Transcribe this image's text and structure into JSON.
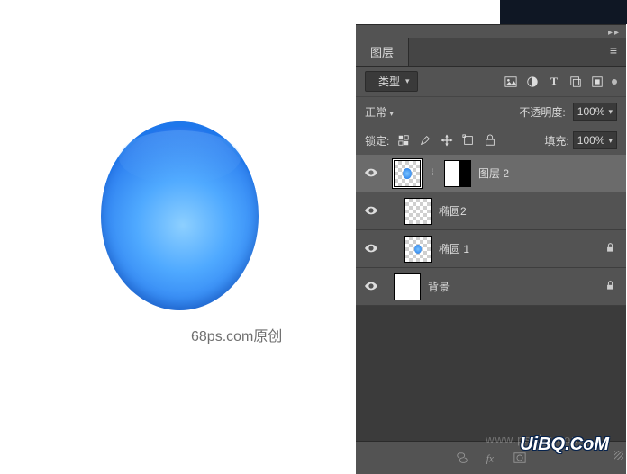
{
  "canvas": {
    "credit": "68ps.com原创"
  },
  "panel": {
    "title": "图层",
    "type_filter": {
      "label": "类型",
      "search_icon": "search"
    },
    "blend_mode": {
      "value": "正常"
    },
    "opacity": {
      "label": "不透明度:",
      "value": "100%"
    },
    "lock": {
      "label": "锁定:"
    },
    "fill": {
      "label": "填充:",
      "value": "100%"
    },
    "layers": [
      {
        "name": "图层 2",
        "visible": true,
        "selected": true,
        "indent": 1,
        "has_mask": true,
        "locked": false,
        "thumb": "checker-ellipse"
      },
      {
        "name": "椭圆2",
        "visible": true,
        "selected": false,
        "indent": 2,
        "has_mask": false,
        "locked": false,
        "thumb": "checker"
      },
      {
        "name": "椭圆 1",
        "visible": true,
        "selected": false,
        "indent": 2,
        "has_mask": false,
        "locked": true,
        "thumb": "checker-ellipse"
      },
      {
        "name": "背景",
        "visible": true,
        "selected": false,
        "indent": 1,
        "has_mask": false,
        "locked": true,
        "thumb": "white"
      }
    ]
  },
  "watermark": {
    "text1": "www.psahz.com",
    "text2": "UiBQ.CoM"
  }
}
